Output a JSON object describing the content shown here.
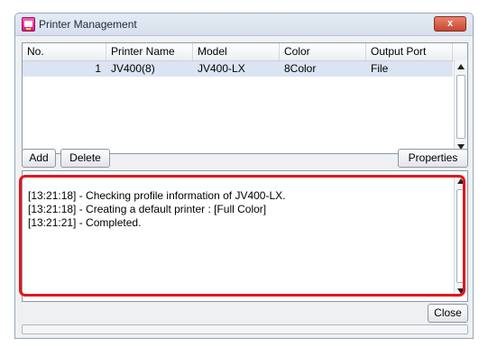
{
  "window": {
    "title": "Printer Management",
    "close_glyph": "x"
  },
  "table": {
    "columns": [
      "No.",
      "Printer Name",
      "Model",
      "Color",
      "Output Port"
    ],
    "rows": [
      {
        "no": "1",
        "printer_name": "JV400(8)",
        "model": "JV400-LX",
        "color": "8Color",
        "output_port": "File"
      }
    ]
  },
  "buttons": {
    "add": "Add",
    "delete": "Delete",
    "properties": "Properties",
    "close": "Close"
  },
  "log": {
    "lines": [
      "[13:21:18] - Checking profile information of JV400-LX.",
      "[13:21:18] - Creating a default printer : [Full Color]",
      "[13:21:21] - Completed."
    ]
  },
  "colors": {
    "highlight_frame": "#e3161b",
    "selected_row": "#dbe4f2",
    "app_icon": "#e0208c"
  },
  "icons": [
    "app-icon",
    "close-icon",
    "scroll-up-arrow-icon",
    "scroll-down-arrow-icon"
  ]
}
